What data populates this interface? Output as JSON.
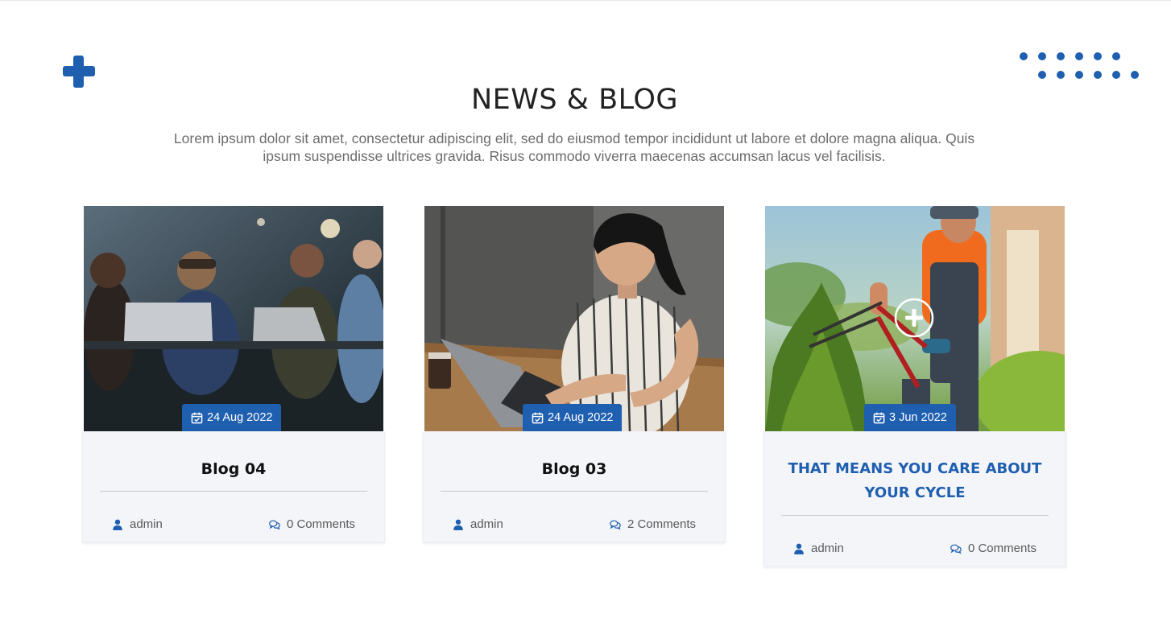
{
  "section": {
    "title": "NEWS & BLOG",
    "description": "Lorem ipsum dolor sit amet, consectetur adipiscing elit, sed do eiusmod tempor incididunt ut labore et dolore magna aliqua. Quis ipsum suspendisse ultrices gravida. Risus commodo viverra maecenas accumsan lacus vel facilisis."
  },
  "colors": {
    "accent": "#1f5fb0",
    "card_bg": "#f4f5f9"
  },
  "posts": [
    {
      "date": "24 Aug 2022",
      "title": "Blog 04",
      "author": "admin",
      "comments": "0 Comments",
      "image": "team-meeting-photo"
    },
    {
      "date": "24 Aug 2022",
      "title": "Blog 03",
      "author": "admin",
      "comments": "2 Comments",
      "image": "woman-laptop-photo"
    },
    {
      "date": "3 Jun 2022",
      "title": "THAT MEANS YOU CARE ABOUT YOUR CYCLE",
      "author": "admin",
      "comments": "0 Comments",
      "image": "gardener-hedge-photo"
    }
  ],
  "icons": {
    "date": "calendar-check-icon",
    "author": "user-icon",
    "comments": "comments-icon",
    "hover": "plus-circle-icon"
  }
}
